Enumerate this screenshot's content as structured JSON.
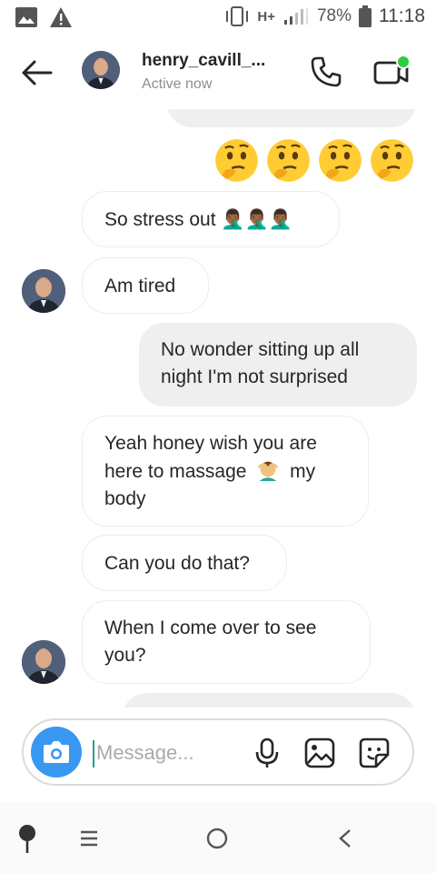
{
  "status_bar": {
    "network": "H+",
    "battery": "78%",
    "time": "11:18",
    "icons": [
      "gallery-icon",
      "warning-icon",
      "vibrate-icon",
      "signal-icon",
      "battery-icon"
    ]
  },
  "header": {
    "title": "henry_cavill_...",
    "subtitle": "Active now",
    "icons": [
      "back-arrow-icon",
      "phone-icon",
      "video-icon"
    ]
  },
  "messages": [
    {
      "id": "m1",
      "side": "out",
      "text": "🤔🤔🤔🤔"
    },
    {
      "id": "m2",
      "side": "in",
      "text": "So stress out 🤦🏾‍♂️🤦🏾‍♂️🤦🏾‍♂️"
    },
    {
      "id": "m3",
      "side": "in",
      "text": "Am tired"
    },
    {
      "id": "m4",
      "side": "out",
      "line1": "No wonder sitting up all",
      "line2": "night I'm not surprised"
    },
    {
      "id": "m5",
      "side": "in",
      "line1": "Yeah honey wish you are",
      "line2a": "here to massage",
      "line2b": "my",
      "line3": "body"
    },
    {
      "id": "m6",
      "side": "in",
      "text": "Can you do that?"
    },
    {
      "id": "m7",
      "side": "in",
      "line1": "When I come over to see",
      "line2": "you?"
    }
  ],
  "composer": {
    "placeholder": "Message...",
    "value": "",
    "icons": [
      "camera-icon",
      "microphone-icon",
      "image-icon",
      "sticker-icon"
    ]
  },
  "navbar": {
    "icons": [
      "pin-icon",
      "menu-icon",
      "home-icon",
      "back-icon"
    ]
  },
  "colors": {
    "accent": "#3897f0",
    "active_dot": "#2ecc40",
    "outgoing_bubble": "#efefef",
    "caret": "#2a9d8f"
  }
}
